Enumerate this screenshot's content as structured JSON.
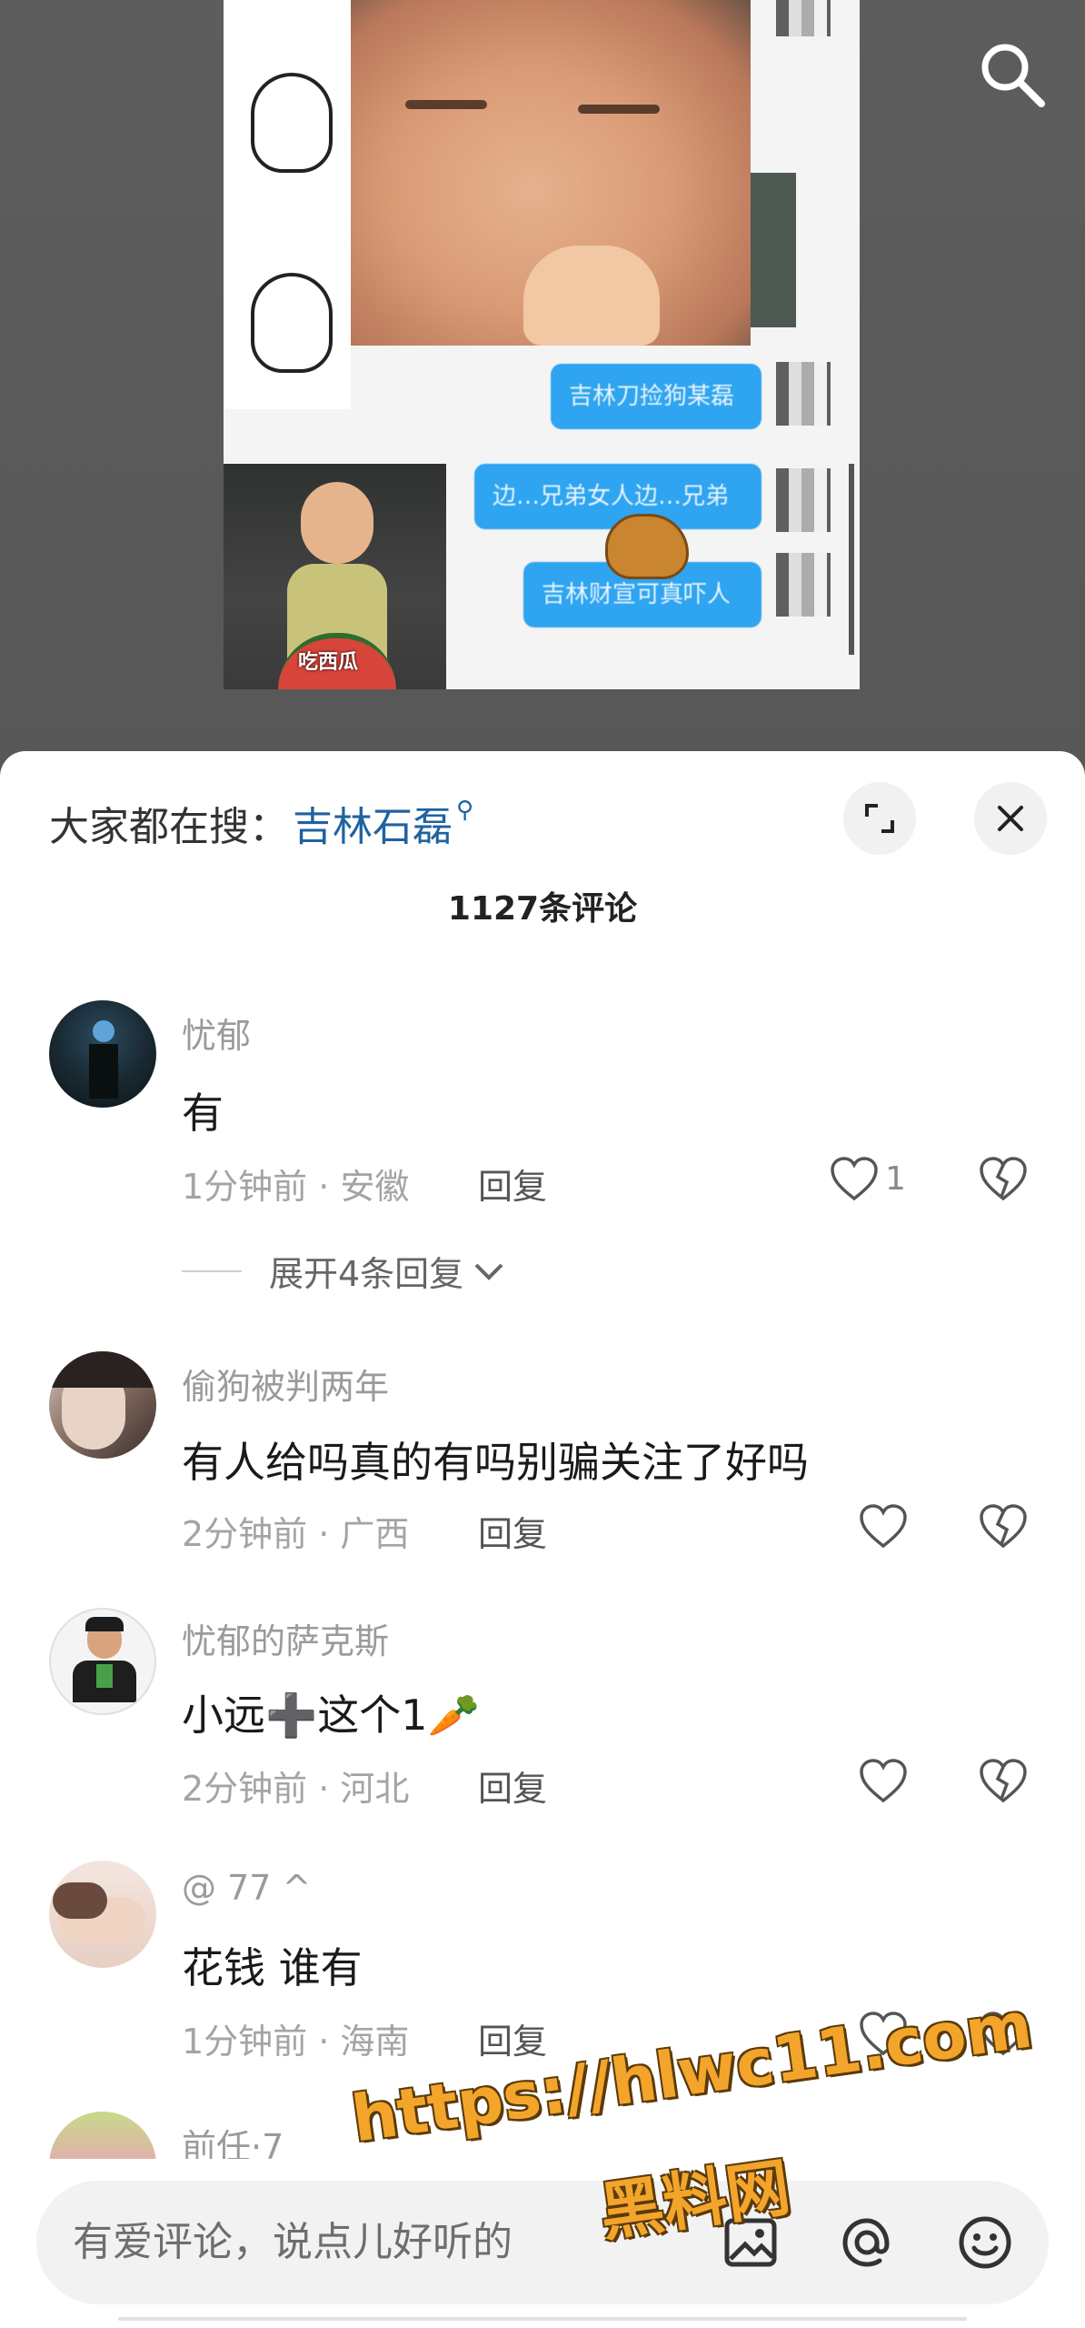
{
  "video": {
    "bubbles": [
      "吉林刀捡狗某磊",
      "边…兄弟女人边…兄弟",
      "吉林财宣可真吓人"
    ],
    "photo_caption": "吃西瓜"
  },
  "sheet": {
    "hot_prefix": "大家都在搜：",
    "hot_term": "吉林石磊",
    "comment_count": "1127条评论"
  },
  "comments": [
    {
      "user": "忧郁",
      "text": "有",
      "time_loc": "1分钟前 · 安徽",
      "reply": "回复",
      "likes": "1"
    },
    {
      "user": "偷狗被判两年",
      "text": "有人给吗真的有吗别骗关注了好吗",
      "time_loc": "2分钟前 · 广西",
      "reply": "回复",
      "likes": ""
    },
    {
      "user": "忧郁的萨克斯",
      "text": "小远➕这个1🥕",
      "time_loc": "2分钟前 · 河北",
      "reply": "回复",
      "likes": ""
    },
    {
      "user": "@ 77 ^",
      "text": "花钱 谁有",
      "time_loc": "1分钟前 · 海南",
      "reply": "回复",
      "likes": ""
    },
    {
      "user": "前任·7",
      "text": "",
      "time_loc": "",
      "reply": "",
      "likes": ""
    }
  ],
  "expand_replies": "展开4条回复",
  "input": {
    "placeholder": "有爱评论，说点儿好听的"
  },
  "watermark": {
    "line1": "https://hlwc11.com",
    "line2": "黑料网"
  },
  "colors": {
    "link": "#20629f",
    "accent_bubble": "#2fa4f0",
    "watermark": "#f3a52b"
  }
}
